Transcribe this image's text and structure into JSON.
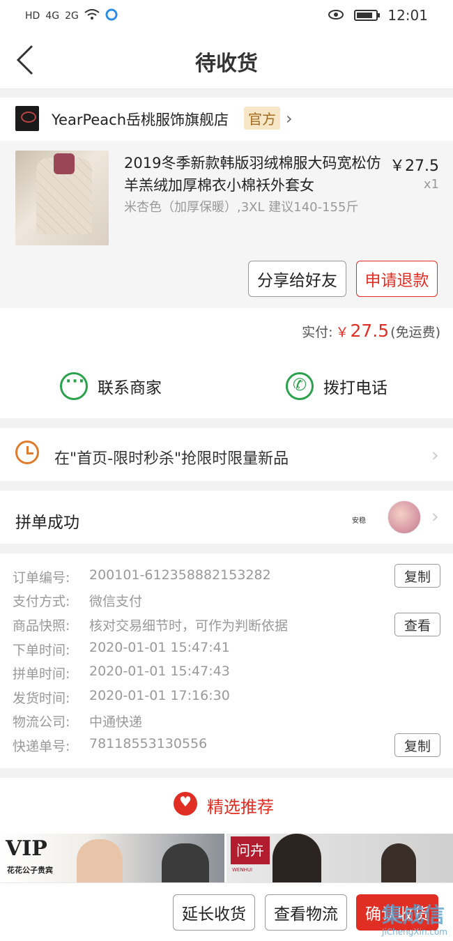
{
  "status_bar": {
    "left": [
      "HD",
      "4G",
      "2G",
      "wifi",
      "app"
    ],
    "time": "12:01"
  },
  "header": {
    "title": "待收货"
  },
  "store": {
    "name": "YearPeach岳桃服饰旗舰店",
    "badge": "官方",
    "chevron": "›"
  },
  "product": {
    "title": "2019冬季新款韩版羽绒棉服大码宽松仿羊羔绒加厚棉衣小棉袄外套女",
    "price": "￥27.5",
    "qty": "x1",
    "spec": "米杏色（加厚保暖）,3XL 建议140-155斤",
    "share_btn": "分享给好友",
    "refund_btn": "申请退款"
  },
  "payment": {
    "label": "实付:",
    "currency": "￥",
    "amount": "27.5",
    "note": "(免运费)"
  },
  "contact": {
    "merchant": "联系商家",
    "call": "拨打电话"
  },
  "promo": {
    "text": "在\"首页-限时秒杀\"抢限时限量新品"
  },
  "group": {
    "text": "拼单成功",
    "note": "安稳"
  },
  "order": {
    "rows": [
      {
        "label": "订单编号:",
        "value": "200101-612358882153282"
      },
      {
        "label": "支付方式:",
        "value": "微信支付"
      },
      {
        "label": "商品快照:",
        "value": "核对交易细节时，可作为判断依据"
      },
      {
        "label": "下单时间:",
        "value": "2020-01-01 15:47:41"
      },
      {
        "label": "拼单时间:",
        "value": "2020-01-01 15:47:43"
      },
      {
        "label": "发货时间:",
        "value": "2020-01-01 17:16:30"
      },
      {
        "label": "物流公司:",
        "value": "中通快递"
      },
      {
        "label": "快递单号:",
        "value": "78118553130556"
      }
    ],
    "copy_btn": "复制",
    "view_btn": "查看",
    "copy_btn2": "复制"
  },
  "recommend": {
    "title": "精选推荐",
    "banner1": {
      "logo": "VIP",
      "sub": "花花公子贵宾"
    },
    "banner2": {
      "logo": "问卉",
      "sub": "WENHUI"
    }
  },
  "bottom": {
    "extend": "延长收货",
    "logistics": "查看物流",
    "confirm": "确认收货"
  },
  "watermark": {
    "big": "集成信",
    "url": "JiChengXin.com"
  },
  "colors": {
    "accent": "#e02e24",
    "green": "#2aa14a",
    "badge_bg": "#f7e7c7"
  }
}
